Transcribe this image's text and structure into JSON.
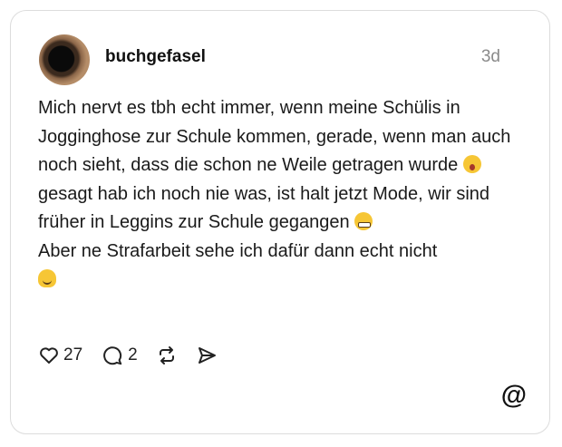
{
  "post": {
    "username": "buchgefasel",
    "timestamp": "3d",
    "text_1": "Mich nervt es tbh echt immer, wenn meine Schülis in Jogginghose zur Schule kommen, gerade, wenn man auch noch sieht, dass die schon ne Weile getragen wurde ",
    "emoji_1": "yawning-face-emoji",
    "text_2": " gesagt hab ich noch nie was, ist halt jetzt Mode, wir sind früher in Leggins zur Schule gegangen ",
    "emoji_2": "grimacing-face-emoji",
    "text_3": "Aber ne Strafarbeit sehe ich dafür dann echt nicht",
    "emoji_3": "melting-face-emoji"
  },
  "actions": {
    "like_icon": "heart-icon",
    "likes": "27",
    "reply_icon": "comment-icon",
    "replies": "2",
    "repost_icon": "repost-icon",
    "share_icon": "send-icon"
  },
  "brand": {
    "logo": "@",
    "logo_icon": "threads-logo-icon"
  },
  "colors": {
    "text": "#111111",
    "muted": "#8a8a8a",
    "border": "#dcdcdc",
    "emoji": "#f6c635"
  }
}
